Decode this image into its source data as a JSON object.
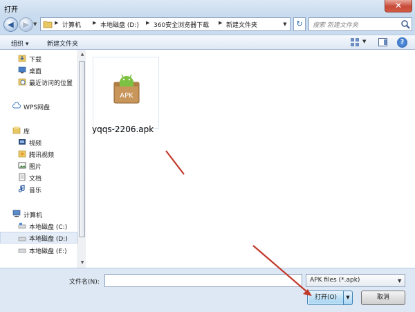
{
  "window": {
    "title": "打开",
    "close_label": "✕"
  },
  "address": {
    "crumbs": [
      "计算机",
      "本地磁盘 (D:)",
      "360安全浏览器下载",
      "新建文件夹"
    ],
    "search_placeholder": "搜索 新建文件夹"
  },
  "toolbar": {
    "organize": "组织 ▾",
    "new_folder": "新建文件夹"
  },
  "nav": {
    "items": [
      {
        "label": "下载"
      },
      {
        "label": "桌面"
      },
      {
        "label": "最近访问的位置"
      },
      {
        "label": "WPS网盘"
      },
      {
        "label": "库"
      },
      {
        "label": "视频"
      },
      {
        "label": "腾讯视频"
      },
      {
        "label": "图片"
      },
      {
        "label": "文档"
      },
      {
        "label": "音乐"
      },
      {
        "label": "计算机"
      },
      {
        "label": "本地磁盘 (C:)"
      },
      {
        "label": "本地磁盘 (D:)"
      },
      {
        "label": "本地磁盘 (E:)"
      }
    ],
    "selected": "本地磁盘 (D:)"
  },
  "files": [
    {
      "name": "yqqs-2206.apk",
      "icon": "apk-file-icon",
      "icon_text": "APK"
    }
  ],
  "bottom": {
    "filename_label": "文件名(N):",
    "filename_value": "",
    "filetype": "APK files (*.apk)",
    "open_label": "打开(O)",
    "cancel_label": "取消"
  },
  "colors": {
    "annotation_arrow": "#c0392b",
    "accent": "#3c7fb1"
  }
}
